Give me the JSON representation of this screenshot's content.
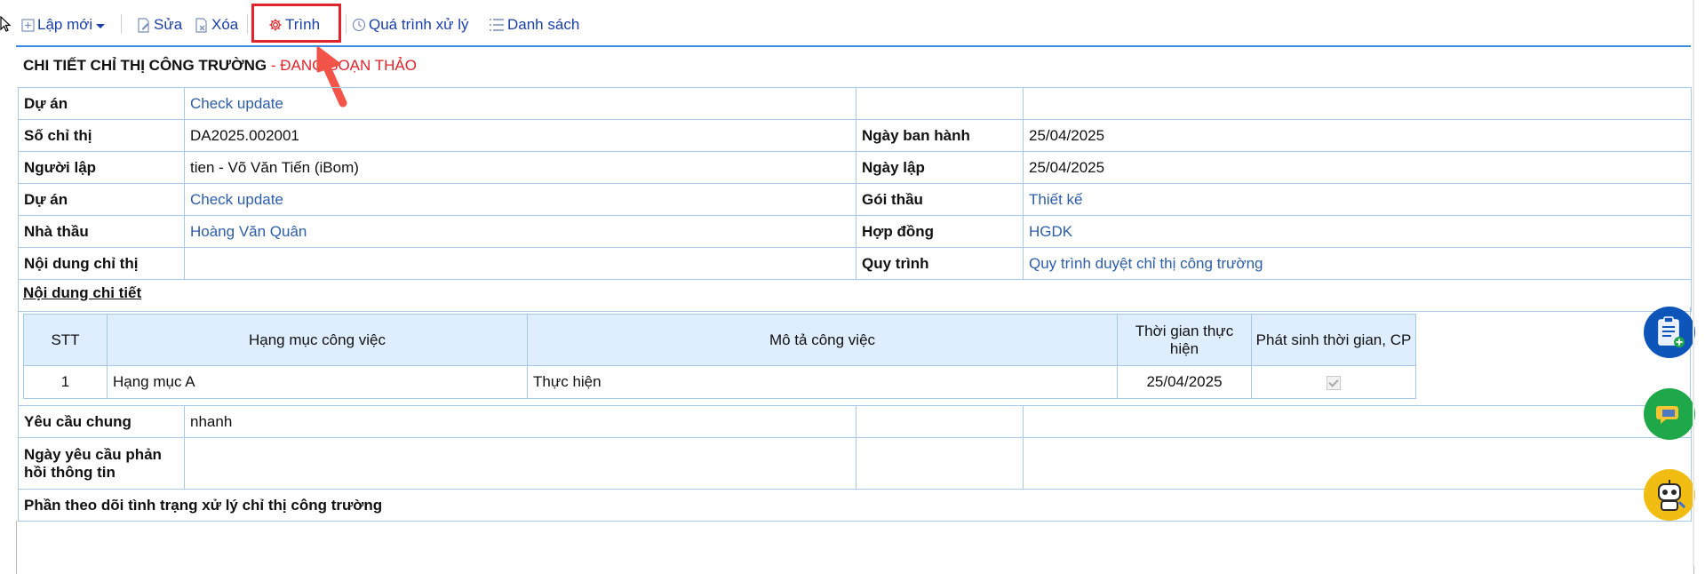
{
  "toolbar": {
    "new_label": "Lập mới",
    "edit_label": "Sửa",
    "delete_label": "Xóa",
    "submit_label": "Trình",
    "process_label": "Quá trình xử lý",
    "list_label": "Danh sách"
  },
  "header": {
    "title": "CHI TIẾT CHỈ THỊ CÔNG TRƯỜNG",
    "status": " - ĐANG SOẠN THẢO"
  },
  "detail": {
    "du_an_label": "Dự án",
    "du_an_value": "Check update",
    "so_chi_thi_label": "Số chỉ thị",
    "so_chi_thi_value": "DA2025.002001",
    "ngay_ban_hanh_label": "Ngày ban hành",
    "ngay_ban_hanh_value": "25/04/2025",
    "nguoi_lap_label": "Người lập",
    "nguoi_lap_value": "tien - Võ Văn Tiến (iBom)",
    "ngay_lap_label": "Ngày lập",
    "ngay_lap_value": "25/04/2025",
    "du_an2_label": "Dự án",
    "du_an2_value": "Check update",
    "goi_thau_label": "Gói thầu",
    "goi_thau_value": "Thiết kế",
    "nha_thau_label": "Nhà thầu",
    "nha_thau_value": "Hoàng Văn Quân",
    "hop_dong_label": "Hợp đồng",
    "hop_dong_value": "HGDK",
    "noi_dung_label": "Nội dung chỉ thị",
    "noi_dung_value": "",
    "quy_trinh_label": "Quy trình",
    "quy_trinh_value": "Quy trình duyệt chỉ thị công trường"
  },
  "details_section": {
    "title": "Nội dung chi tiết",
    "columns": [
      "STT",
      "Hạng mục công việc",
      "Mô tả công việc",
      "Thời gian thực hiện",
      "Phát sinh thời gian, CP"
    ],
    "rows": [
      {
        "stt": "1",
        "hang_muc": "Hạng mục A",
        "mo_ta": "Thực hiện",
        "thoi_gian": "25/04/2025",
        "phat_sinh": true
      }
    ]
  },
  "requirements": {
    "yeu_cau_label": "Yêu cầu chung",
    "yeu_cau_value": "nhanh",
    "ngay_yeu_cau_label": "Ngày yêu cầu phản hồi thông tin",
    "ngay_yeu_cau_value": "",
    "tracking_label": "Phần theo dõi tình trạng xử lý chỉ thị công trường"
  },
  "colors": {
    "link": "#2d5da8",
    "toolbar_text": "#1a3fa8",
    "status": "#e0242b",
    "border": "#a7c8e6",
    "header_bg": "#dfeeff"
  },
  "icons": [
    "cursor-icon",
    "add-icon",
    "caret-down-icon",
    "edit-doc-icon",
    "delete-doc-icon",
    "gear-icon",
    "clock-icon",
    "list-icon",
    "annotation-arrow-icon",
    "clipboard-add-icon",
    "chat-icon",
    "robot-icon"
  ]
}
